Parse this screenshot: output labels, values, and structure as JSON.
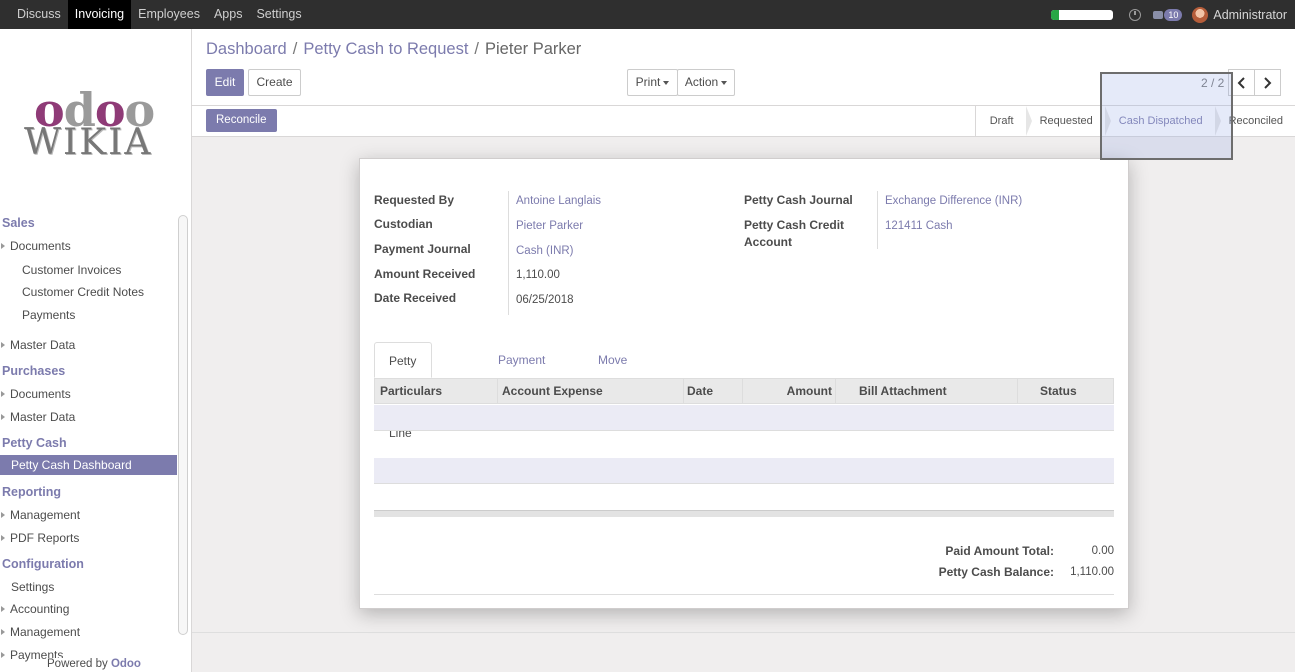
{
  "topbar": {
    "menu": [
      "Discuss",
      "Invoicing",
      "Employees",
      "Apps",
      "Settings"
    ],
    "active": "Invoicing",
    "progress_fraction": 0.12,
    "chat_count": "10",
    "user": "Administrator"
  },
  "sidebar": {
    "logo_top": "odoo",
    "logo_bottom": "WIKIA",
    "sections": {
      "sales": "Sales",
      "purchases": "Purchases",
      "petty_cash": "Petty Cash",
      "reporting": "Reporting",
      "configuration": "Configuration"
    },
    "items": {
      "sales_documents": "Documents",
      "customer_invoices": "Customer Invoices",
      "customer_credit_notes": "Customer Credit Notes",
      "payments": "Payments",
      "sales_master_data": "Master Data",
      "purch_documents": "Documents",
      "purch_master_data": "Master Data",
      "petty_cash_dashboard": "Petty Cash Dashboard",
      "management": "Management",
      "pdf_reports": "PDF Reports",
      "settings": "Settings",
      "accounting": "Accounting",
      "conf_management": "Management",
      "conf_payments": "Payments"
    },
    "powered_by": "Powered by",
    "powered_brand": "Odoo"
  },
  "breadcrumb": [
    "Dashboard",
    "Petty Cash to Request",
    "Pieter Parker"
  ],
  "toolbar": {
    "edit": "Edit",
    "create": "Create",
    "print": "Print",
    "action": "Action",
    "pager": "2 / 2"
  },
  "statusbar": {
    "reconcile": "Reconcile",
    "stages": [
      "Draft",
      "Requested",
      "Cash Dispatched",
      "Reconciled"
    ],
    "active_stage": "Cash Dispatched"
  },
  "form": {
    "labels": {
      "requested_by": "Requested By",
      "custodian": "Custodian",
      "payment_journal": "Payment Journal",
      "amount_received": "Amount Received",
      "date_received": "Date Received",
      "petty_cash_journal": "Petty Cash Journal",
      "credit_account": "Petty Cash Credit Account"
    },
    "values": {
      "requested_by": "Antoine Langlais",
      "custodian": "Pieter Parker",
      "payment_journal": "Cash (INR)",
      "amount_received": "1,110.00",
      "date_received": "06/25/2018",
      "petty_cash_journal": "Exchange Difference (INR)",
      "credit_account": "121411 Cash"
    },
    "tabs": [
      "Petty Cash Line",
      "Payment Line",
      "Move Line"
    ],
    "active_tab": "Petty Cash Line",
    "columns": [
      "Particulars",
      "Account Expense",
      "Date",
      "Amount",
      "Bill Attachment",
      "Status"
    ],
    "totals": {
      "paid_label": "Paid Amount Total:",
      "paid_value": "0.00",
      "balance_label": "Petty Cash Balance:",
      "balance_value": "1,110.00"
    }
  },
  "colors": {
    "accent": "#7c7bad",
    "topbar": "#2f2f2f"
  }
}
